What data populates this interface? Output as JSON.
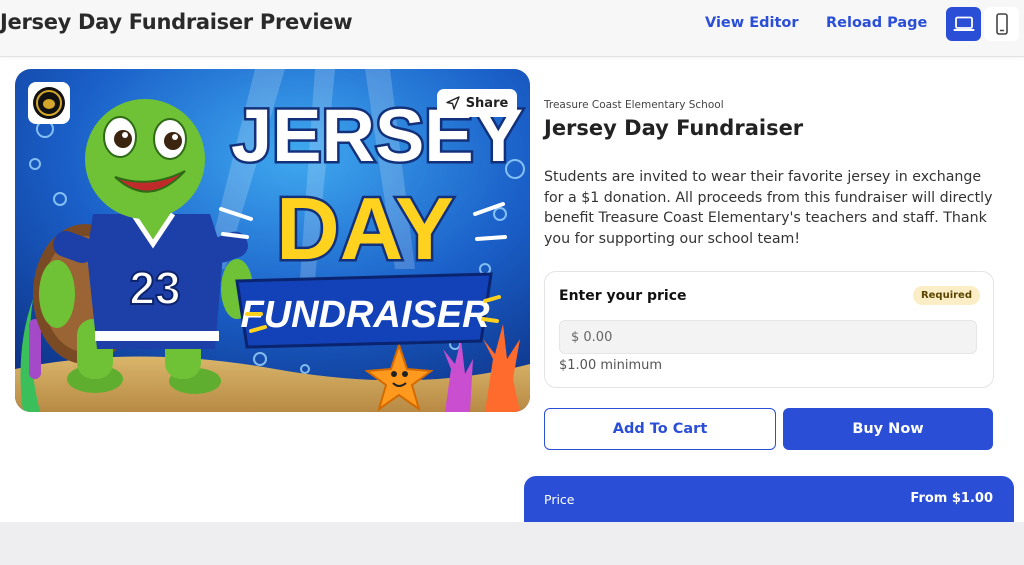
{
  "header": {
    "title": "Jersey Day Fundraiser Preview",
    "view_editor": "View Editor",
    "reload_page": "Reload Page",
    "device_icons": [
      "laptop-icon",
      "mobile-phone-icon"
    ],
    "accent_color": "#2a4fd6"
  },
  "hero": {
    "share_label": "Share",
    "art_text": {
      "line1": "JERSEY",
      "line2": "DAY",
      "line3": "FUNDRAISER",
      "jersey_number": "23"
    },
    "icons": [
      "school-logo-icon",
      "send-icon",
      "turtle-mascot-icon",
      "starfish-icon"
    ]
  },
  "product": {
    "school": "Treasure Coast Elementary School",
    "title": "Jersey Day Fundraiser",
    "description": "Students are invited to wear their favorite jersey in exchange for a $1 donation. All proceeds from this fundraiser will directly benefit Treasure Coast Elementary's teachers and staff. Thank you for supporting our school team!"
  },
  "price_entry": {
    "label": "Enter your price",
    "required": "Required",
    "placeholder": "$ 0.00",
    "minimum": "$1.00 minimum"
  },
  "actions": {
    "add_to_cart": "Add To Cart",
    "buy_now": "Buy Now"
  },
  "price_bar": {
    "label": "Price",
    "value": "From $1.00"
  }
}
